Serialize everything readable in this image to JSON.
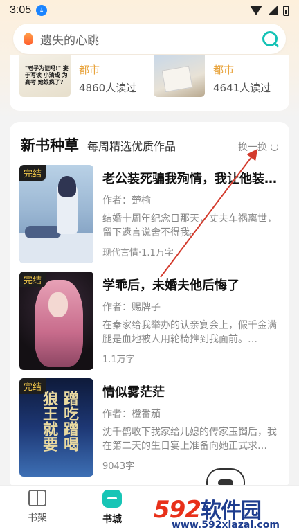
{
  "status_bar": {
    "time": "3:05"
  },
  "search": {
    "placeholder": "遗失的心跳"
  },
  "prev_books": [
    {
      "cover_text": "\"老子为证吗!\" 妄于写读 小清成 为高考 她娘疯了?",
      "genre": "都市",
      "readers": "4860人读过"
    },
    {
      "genre": "都市",
      "readers": "4641人读过"
    }
  ],
  "section": {
    "title": "新书种草",
    "subtitle": "每周精选优质作品",
    "refresh_label": "换一换"
  },
  "books": [
    {
      "tag": "完结",
      "title": "老公装死骗我殉情，我让他装…",
      "author": "作者：楚榆",
      "desc": "结婚十周年纪念日那天，丈夫车祸离世，留下遗言说舍不得我。",
      "meta": "现代言情·1.1万字"
    },
    {
      "tag": "完结",
      "title": "学乖后，未婚夫他后悔了",
      "author": "作者：赐牌子",
      "desc": "在秦家给我举办的认亲宴会上，假千金满腿是血地被人用轮椅推到我面前。…",
      "meta": "1.1万字"
    },
    {
      "tag": "完结",
      "title": "情似雾茫茫",
      "author": "作者：橙番茄",
      "desc": "沈千鹤收下我家给儿媳的传家玉镯后，我在第二天的生日宴上准备向她正式求…",
      "meta": "9043字",
      "cover_text_1": "蹭吃蹭喝",
      "cover_text_2": "狼王就要"
    }
  ],
  "nav": {
    "shelf_label": "书架",
    "store_label": "书城"
  },
  "watermark": {
    "brand_num": "592",
    "brand_cn": "软件园",
    "url": "www.592xiazai.com"
  },
  "colors": {
    "accent": "#13c2b5",
    "genre": "#e8a33b",
    "annotation_arrow": "#d33a2c"
  }
}
